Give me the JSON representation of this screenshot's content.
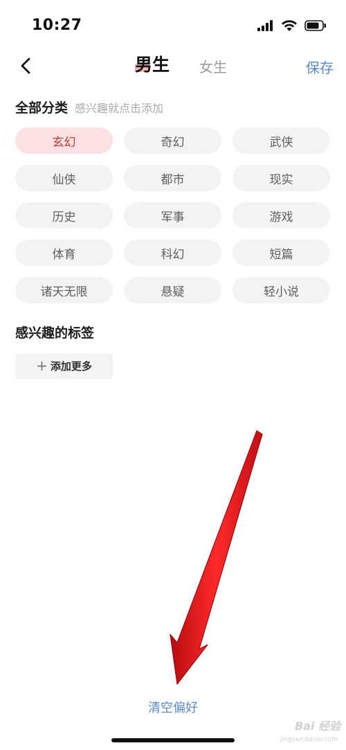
{
  "status_bar": {
    "time": "10:27"
  },
  "nav": {
    "tab_male": "男生",
    "tab_female": "女生",
    "save_label": "保存"
  },
  "categories": {
    "title": "全部分类",
    "hint": "感兴趣就点击添加",
    "items": [
      {
        "label": "玄幻",
        "selected": true
      },
      {
        "label": "奇幻",
        "selected": false
      },
      {
        "label": "武侠",
        "selected": false
      },
      {
        "label": "仙侠",
        "selected": false
      },
      {
        "label": "都市",
        "selected": false
      },
      {
        "label": "现实",
        "selected": false
      },
      {
        "label": "历史",
        "selected": false
      },
      {
        "label": "军事",
        "selected": false
      },
      {
        "label": "游戏",
        "selected": false
      },
      {
        "label": "体育",
        "selected": false
      },
      {
        "label": "科幻",
        "selected": false
      },
      {
        "label": "短篇",
        "selected": false
      },
      {
        "label": "诸天无限",
        "selected": false
      },
      {
        "label": "悬疑",
        "selected": false
      },
      {
        "label": "轻小说",
        "selected": false
      }
    ]
  },
  "tags": {
    "title": "感兴趣的标签",
    "add_more_label": "添加更多"
  },
  "footer": {
    "clear_label": "清空偏好"
  },
  "watermark": {
    "text": "Bai 经验",
    "sub": "jingyan.baidu.com"
  },
  "colors": {
    "accent": "#5a8ac7",
    "selected_bg": "#fbe1e1",
    "selected_text": "#c23a3a",
    "annotation_arrow": "#e8141b"
  }
}
